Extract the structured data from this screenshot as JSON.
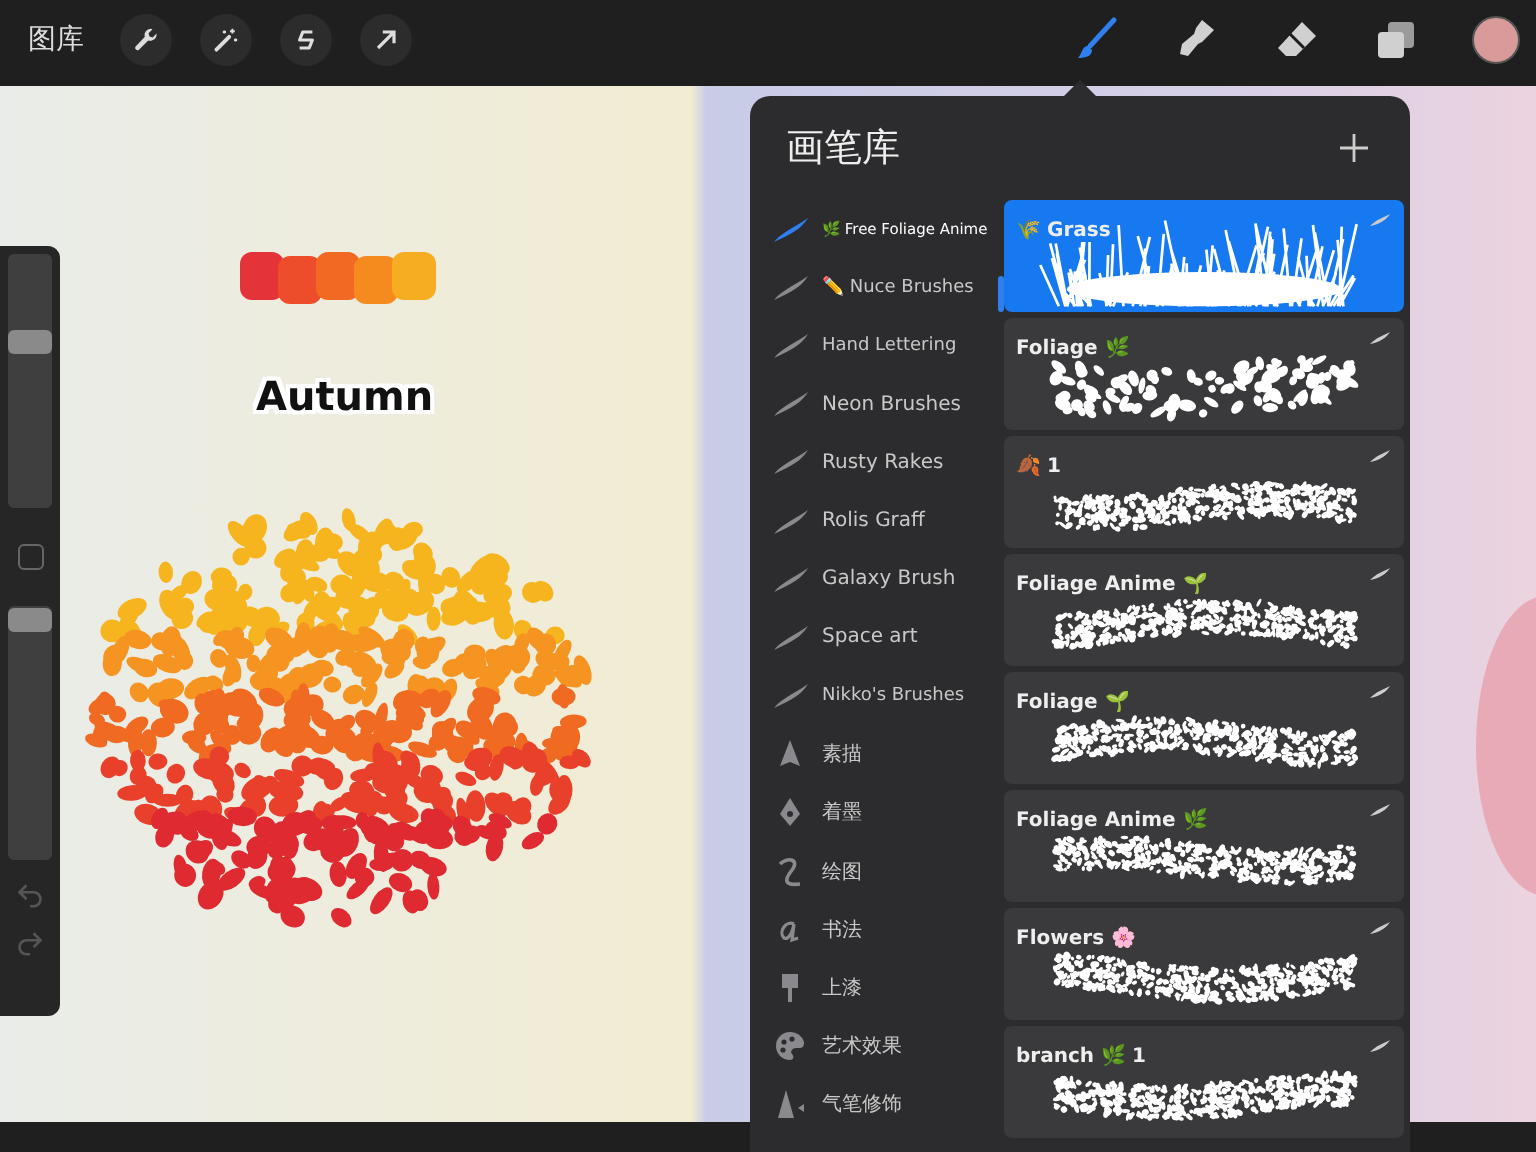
{
  "toolbar": {
    "gallery": "图库",
    "tools": [
      {
        "kind": "brush",
        "selected": true
      },
      {
        "kind": "smudge",
        "selected": false
      },
      {
        "kind": "eraser",
        "selected": false
      },
      {
        "kind": "layers",
        "selected": false
      }
    ]
  },
  "canvas": {
    "caption": "Autumn"
  },
  "sidebar": {
    "size": {
      "level": 0.65
    },
    "opacity": {
      "level": 0.96
    }
  },
  "brush_library": {
    "title": "画笔库",
    "sets": [
      {
        "label": "🌿 Free Foliage Anime",
        "kind": "set",
        "selected": true
      },
      {
        "label": "✏️ Nuce Brushes",
        "kind": "set",
        "selected": false
      },
      {
        "label": "Hand Lettering",
        "kind": "set",
        "selected": false
      },
      {
        "label": "Neon Brushes",
        "kind": "set",
        "selected": false
      },
      {
        "label": "Rusty Rakes",
        "kind": "set",
        "selected": false
      },
      {
        "label": "Rolis Graff",
        "kind": "set",
        "selected": false
      },
      {
        "label": "Galaxy Brush",
        "kind": "set",
        "selected": false
      },
      {
        "label": "Space art",
        "kind": "set",
        "selected": false
      },
      {
        "label": "Nikko's Brushes",
        "kind": "set",
        "selected": false
      },
      {
        "label": "素描",
        "kind": "sketching",
        "selected": false
      },
      {
        "label": "着墨",
        "kind": "inking",
        "selected": false
      },
      {
        "label": "绘图",
        "kind": "drawing",
        "selected": false
      },
      {
        "label": "书法",
        "kind": "calligraphy",
        "selected": false
      },
      {
        "label": "上漆",
        "kind": "painting",
        "selected": false
      },
      {
        "label": "艺术效果",
        "kind": "artistic",
        "selected": false
      },
      {
        "label": "气笔修饰",
        "kind": "airbrushing",
        "selected": false
      }
    ],
    "brushes": [
      {
        "name": "🌾 Grass",
        "kind": "grass",
        "selected": true
      },
      {
        "name": "Foliage 🌿",
        "kind": "leaves",
        "selected": false
      },
      {
        "name": "🍂 1",
        "kind": "speckle",
        "selected": false
      },
      {
        "name": "Foliage Anime 🌱",
        "kind": "speckle",
        "selected": false
      },
      {
        "name": "Foliage 🌱",
        "kind": "speckle",
        "selected": false
      },
      {
        "name": "Foliage Anime 🌿",
        "kind": "speckle",
        "selected": false
      },
      {
        "name": "Flowers 🌸",
        "kind": "speckle",
        "selected": false
      },
      {
        "name": "branch 🌿 1",
        "kind": "speckle",
        "selected": false
      }
    ]
  }
}
